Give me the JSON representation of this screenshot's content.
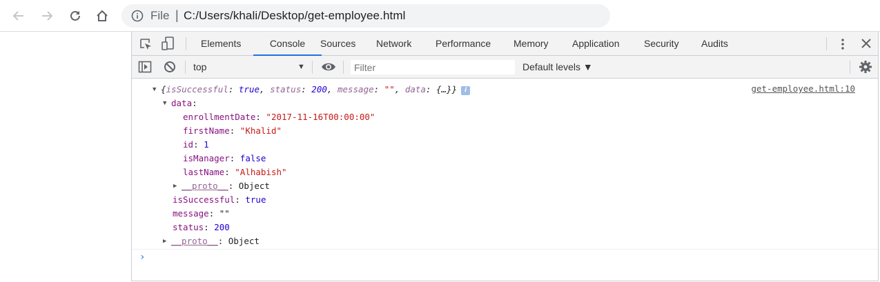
{
  "browser": {
    "omnibox": {
      "scheme_label": "File",
      "separator": "|",
      "url": "C:/Users/khali/Desktop/get-employee.html"
    },
    "icons": [
      "back-arrow-icon",
      "forward-arrow-icon",
      "reload-icon",
      "home-icon",
      "info-icon"
    ]
  },
  "devtools": {
    "tabs": [
      "Elements",
      "Console",
      "Sources",
      "Network",
      "Performance",
      "Memory",
      "Application",
      "Security",
      "Audits"
    ],
    "active_tab": "Console",
    "toolbar": {
      "context": "top",
      "filter_placeholder": "Filter",
      "levels": "Default levels ▼"
    },
    "console": {
      "source_link": "get-employee.html:10",
      "summary": {
        "open": "{",
        "k1": "isSuccessful",
        "v1": "true",
        "k2": "status",
        "v2": "200",
        "k3": "message",
        "v3": "\"\"",
        "k4": "data",
        "v4": "{…}",
        "close": "}",
        "badge": "i"
      },
      "data_key": "data",
      "data_fields": {
        "enrollmentDate_key": "enrollmentDate",
        "enrollmentDate_val": "\"2017-11-16T00:00:00\"",
        "firstName_key": "firstName",
        "firstName_val": "\"Khalid\"",
        "id_key": "id",
        "id_val": "1",
        "isManager_key": "isManager",
        "isManager_val": "false",
        "lastName_key": "lastName",
        "lastName_val": "\"Alhabish\"",
        "proto_key": "__proto__",
        "proto_val": "Object"
      },
      "root_fields": {
        "isSuccessful_key": "isSuccessful",
        "isSuccessful_val": "true",
        "message_key": "message",
        "message_val": "\"\"",
        "status_key": "status",
        "status_val": "200",
        "proto_key": "__proto__",
        "proto_val": "Object"
      },
      "prompt": "›"
    }
  }
}
